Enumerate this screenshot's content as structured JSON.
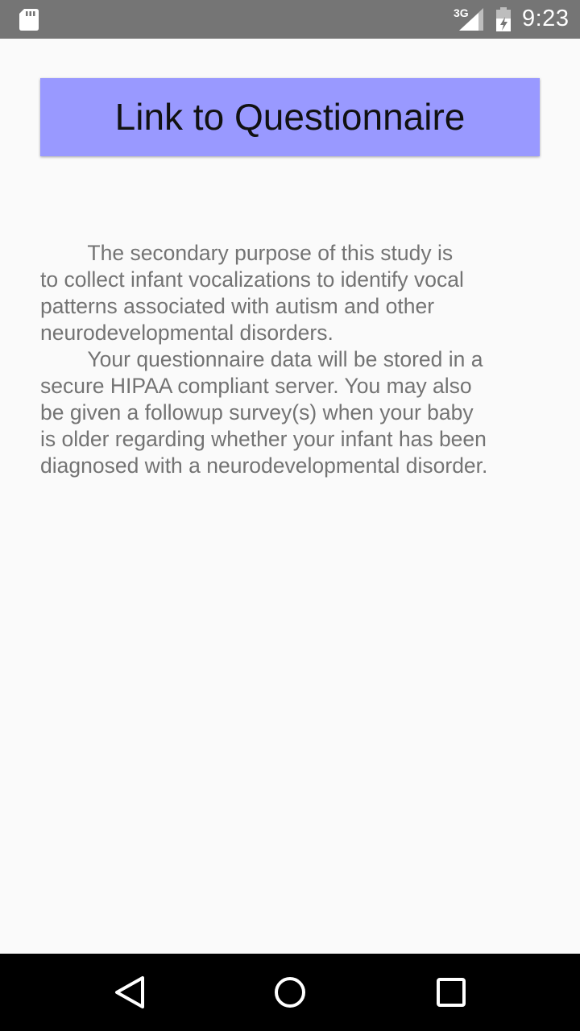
{
  "status_bar": {
    "time": "9:23",
    "network": "3G",
    "icons": [
      "sd-card-icon",
      "signal-icon",
      "battery-icon"
    ]
  },
  "main": {
    "questionnaire_button_label": "Link to Questionnaire",
    "body_lines": [
      "        The secondary purpose of this study is",
      "to collect infant vocalizations to identify vocal",
      "patterns associated with autism and other",
      "neurodevelopmental disorders.",
      "        Your questionnaire data will be stored in a",
      "secure HIPAA compliant server. You may also",
      "be given a followup survey(s) when your baby",
      "is older regarding whether your infant has been",
      "diagnosed with a neurodevelopmental disorder."
    ]
  },
  "nav_bar": {
    "icons": [
      "back-icon",
      "home-icon",
      "recents-icon"
    ]
  },
  "colors": {
    "status_bar": "#757575",
    "button": "#9999ff",
    "body_text": "#737373",
    "background": "#fafafa",
    "nav_bar": "#000000"
  }
}
